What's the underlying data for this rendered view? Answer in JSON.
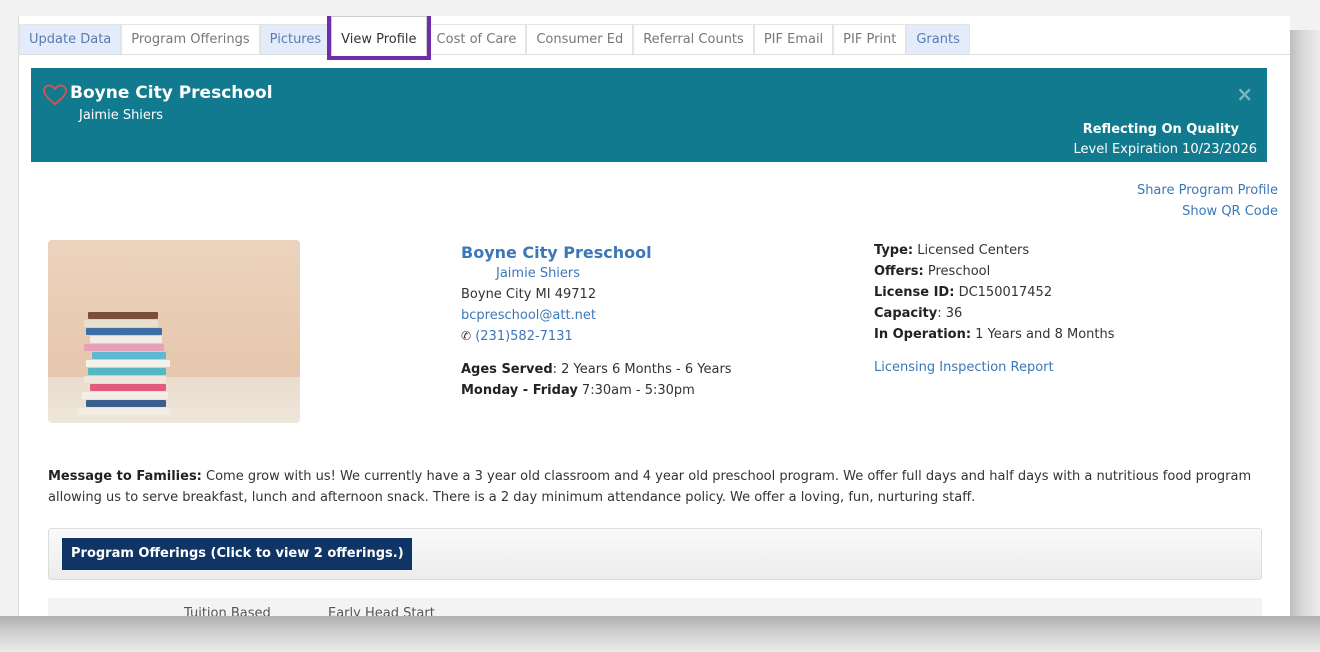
{
  "tabs": [
    {
      "label": "Update Data",
      "style": "blue"
    },
    {
      "label": "Program Offerings",
      "style": "plain"
    },
    {
      "label": "Pictures",
      "style": "blue"
    },
    {
      "label": "View Profile",
      "style": "active"
    },
    {
      "label": "Cost of Care",
      "style": "plain"
    },
    {
      "label": "Consumer Ed",
      "style": "plain"
    },
    {
      "label": "Referral Counts",
      "style": "plain"
    },
    {
      "label": "PIF Email",
      "style": "plain"
    },
    {
      "label": "PIF Print",
      "style": "plain"
    },
    {
      "label": "Grants",
      "style": "blue"
    }
  ],
  "banner": {
    "title": "Boyne City Preschool",
    "subtitle": "Jaimie Shiers",
    "close": "×",
    "quality": "Reflecting On Quality",
    "expiration": "Level Expiration 10/23/2026",
    "color": "#127a8e"
  },
  "links": {
    "share": "Share Program Profile",
    "qr": "Show QR Code"
  },
  "contact": {
    "name": "Boyne City Preschool",
    "owner": "Jaimie Shiers",
    "city": "Boyne City MI 49712",
    "email": "bcpreschool@att.net",
    "phone": "(231)582-7131",
    "ages_label": "Ages Served",
    "ages_value": ": 2 Years 6 Months - 6 Years",
    "hours_label": "Monday - Friday",
    "hours_value": " 7:30am - 5:30pm"
  },
  "details": {
    "type_label": "Type:",
    "type_value": " Licensed Centers",
    "offers_label": "Offers:",
    "offers_value": " Preschool",
    "license_label": "License ID:",
    "license_value": " DC150017452",
    "capacity_label": "Capacity",
    "capacity_value": ": 36",
    "operation_label": "In Operation:",
    "operation_value": " 1 Years and 8 Months",
    "inspection_link": "Licensing Inspection Report"
  },
  "message": {
    "label": "Message to Families:",
    "text": " Come grow with us! We currently have a 3 year old classroom and 4 year old preschool program. We offer full days and half days with a nutritious food program allowing us to serve breakfast, lunch and afternoon snack. There is a 2 day minimum attendance policy. We offer a loving, fun, nurturing staff."
  },
  "program_offerings": {
    "button": "Program Offerings (Click to view 2 offerings.)",
    "items": [
      "Tuition Based",
      "Early Head Start"
    ]
  },
  "icons": {
    "heart": "heart-outline-icon",
    "phone": "phone-icon"
  },
  "colors": {
    "link": "#3b78b8",
    "active_tab_outline": "#6f2da8",
    "offerings_button": "#0f3466"
  }
}
